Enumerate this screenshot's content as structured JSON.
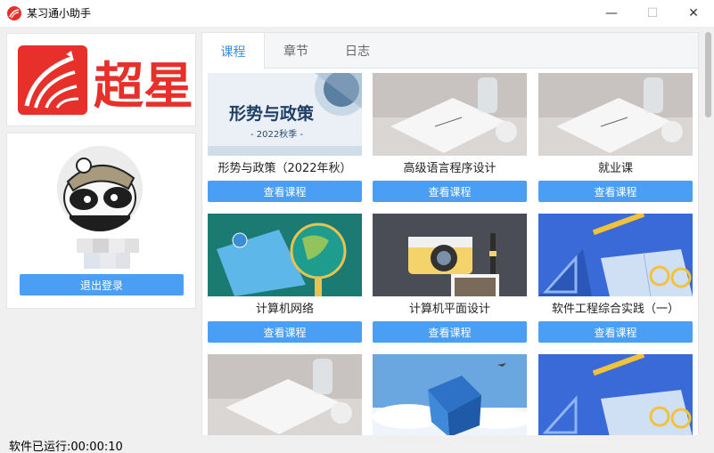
{
  "window": {
    "title": "某习通小助手",
    "minimize_glyph": "—",
    "maximize_glyph": "☐",
    "close_glyph": "✕"
  },
  "brand": {
    "logo_text": "超星",
    "color": "#e8302a"
  },
  "user": {
    "logout_label": "退出登录"
  },
  "tabs": [
    {
      "label": "课程",
      "active": true
    },
    {
      "label": "章节",
      "active": false
    },
    {
      "label": "日志",
      "active": false
    }
  ],
  "courses": [
    {
      "name": "形势与政策（2022年秋）",
      "button": "查看课程",
      "thumb": "policy",
      "thumb_title": "形势与政策",
      "thumb_sub": "- 2022秋季 -"
    },
    {
      "name": "高级语言程序设计",
      "button": "查看课程",
      "thumb": "desk"
    },
    {
      "name": "就业课",
      "button": "查看课程",
      "thumb": "desk"
    },
    {
      "name": "计算机网络",
      "button": "查看课程",
      "thumb": "globe-green"
    },
    {
      "name": "计算机平面设计",
      "button": "查看课程",
      "thumb": "camera"
    },
    {
      "name": "软件工程综合实践（一）",
      "button": "查看课程",
      "thumb": "blue-book"
    },
    {
      "name": "",
      "button": "",
      "thumb": "desk"
    },
    {
      "name": "",
      "button": "",
      "thumb": "globe-cube"
    },
    {
      "name": "",
      "button": "",
      "thumb": "blue-book"
    }
  ],
  "status": {
    "runtime": "软件已运行:00:00:10"
  },
  "colors": {
    "accent": "#4a9ff5",
    "tab_active": "#3a8ee6"
  }
}
